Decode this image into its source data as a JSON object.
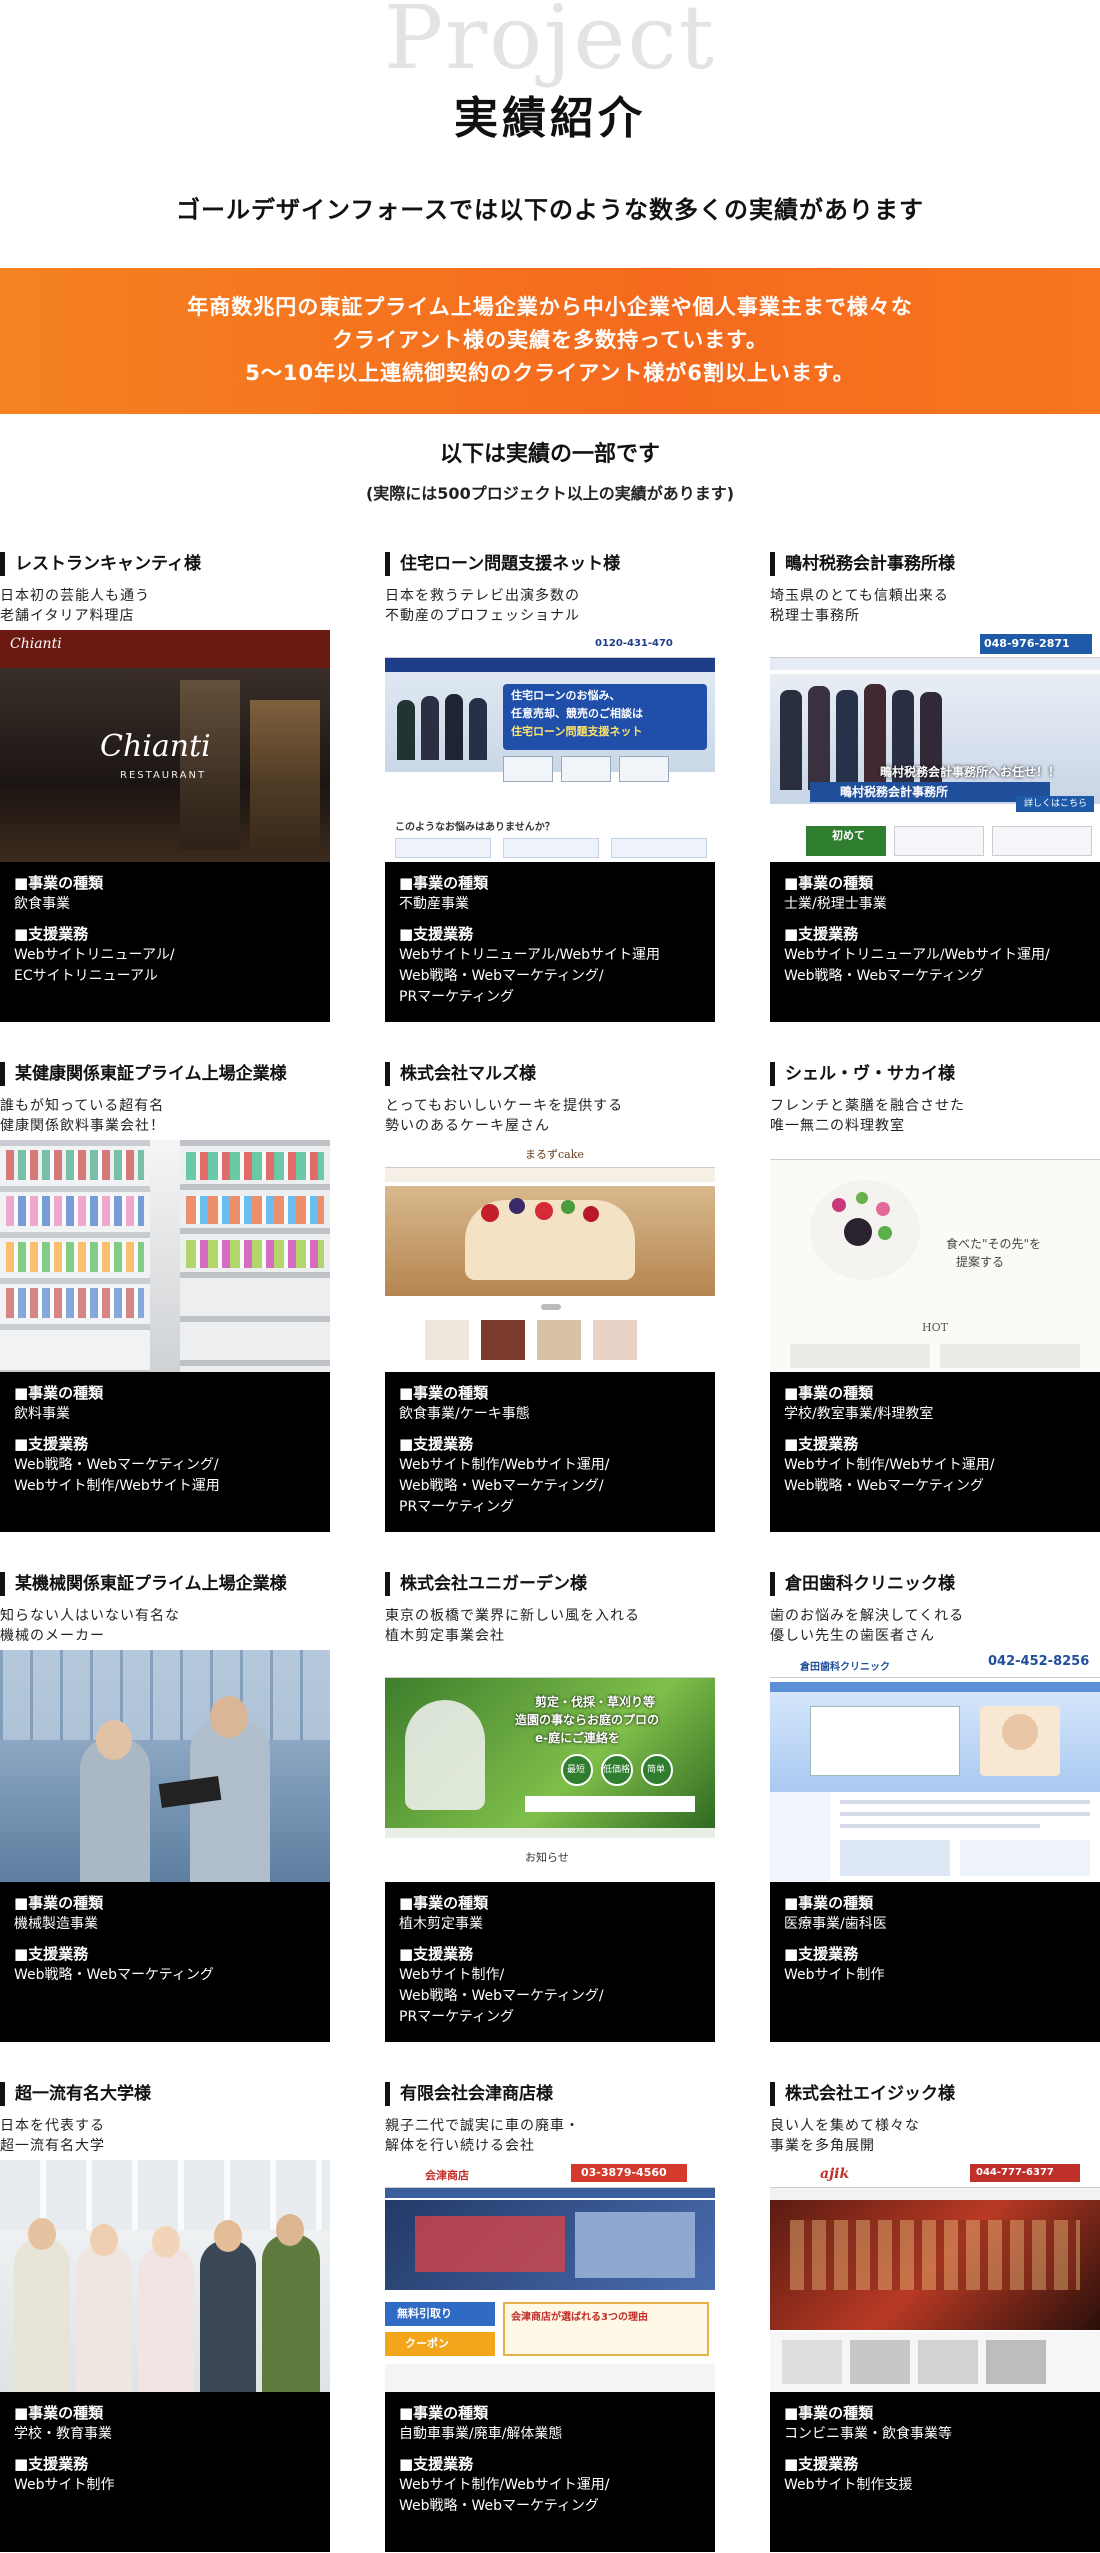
{
  "header": {
    "project_word": "Project",
    "title": "実績紹介"
  },
  "lead": "ゴールデザインフォースでは以下のような数多くの実績があります",
  "banner": {
    "lines": [
      "年商数兆円の東証プライム上場企業から中小企業や個人事業主まで様々な",
      "クライアント様の実績を多数持っています。",
      "5〜10年以上連続御契約のクライアント様が6割以上います。"
    ],
    "color": "#f58220"
  },
  "sub": {
    "line1": "以下は実績の一部です",
    "line2": "(実際には500プロジェクト以上の実績があります)"
  },
  "labels": {
    "industry": "■事業の種類",
    "support": "■支援業務"
  },
  "cards": [
    {
      "title": "レストランキャンティ様",
      "desc": [
        "日本初の芸能人も通う",
        "老舗イタリア料理店"
      ],
      "industry": "飲食事業",
      "support": [
        "Webサイトリニューアル/",
        "ECサイトリニューアル"
      ],
      "shot_text": [
        "Chianti",
        "RESTAURANT"
      ]
    },
    {
      "title": "住宅ローン問題支援ネット様",
      "desc": [
        "日本を救うテレビ出演多数の",
        "不動産のプロフェッショナル"
      ],
      "industry": "不動産事業",
      "support": [
        "Webサイトリニューアル/Webサイト運用",
        "Web戦略・Webマーケティング/",
        "PRマーケティング"
      ],
      "shot_text": [
        "住宅ローンのお悩み、",
        "任意売却、競売のご相談は",
        "住宅ローン問題支援ネット",
        "0120-431-470",
        "このようなお悩みはありませんか？"
      ]
    },
    {
      "title": "鴫村税務会計事務所様",
      "desc": [
        "埼玉県のとても信頼出来る",
        "税理士事務所"
      ],
      "industry": "士業/税理士事業",
      "support": [
        "Webサイトリニューアル/Webサイト運用/",
        "Web戦略・Webマーケティング"
      ],
      "shot_text": [
        "鴫村税務会計事務所",
        "048-976-2871",
        "鴫村税務会計事務所へお任せ！！",
        "初めて",
        "詳しくはこちら"
      ]
    },
    {
      "title": "某健康関係東証プライム上場企業様",
      "desc": [
        "誰もが知っている超有名",
        "健康関係飲料事業会社！"
      ],
      "industry": "飲料事業",
      "support": [
        "Web戦略・Webマーケティング/",
        "Webサイト制作/Webサイト運用"
      ],
      "shot_text": []
    },
    {
      "title": "株式会社マルズ様",
      "desc": [
        "とってもおいしいケーキを提供する",
        "勢いのあるケーキ屋さん"
      ],
      "industry": "飲食事業/ケーキ事態",
      "support": [
        "Webサイト制作/Webサイト運用/",
        "Web戦略・Webマーケティング/",
        "PRマーケティング"
      ],
      "shot_text": [
        "まるずcake"
      ]
    },
    {
      "title": "シェル・ヴ・サカイ様",
      "desc": [
        "フレンチと薬膳を融合させた",
        "唯一無二の料理教室"
      ],
      "industry": "学校/教室事業/料理教室",
      "support": [
        "Webサイト制作/Webサイト運用/",
        "Web戦略・Webマーケティング"
      ],
      "shot_text": [
        "食べた\"その先\"を",
        "提案する",
        "HOT"
      ]
    },
    {
      "title": "某機械関係東証プライム上場企業様",
      "desc": [
        "知らない人はいない有名な",
        "機械のメーカー"
      ],
      "industry": "機械製造事業",
      "support": [
        "Web戦略・Webマーケティング"
      ],
      "shot_text": []
    },
    {
      "title": "株式会社ユニガーデン様",
      "desc": [
        "東京の板橋で業界に新しい風を入れる",
        "植木剪定事業会社"
      ],
      "industry": "植木剪定事業",
      "support": [
        "Webサイト制作/",
        "Web戦略・Webマーケティング/",
        "PRマーケティング"
      ],
      "shot_text": [
        "剪定・伐採・草刈り等",
        "造園の事ならお庭のプロの",
        "e-庭にご連絡を",
        "最短",
        "低価格",
        "简单",
        "お知らせ"
      ]
    },
    {
      "title": "倉田歯科クリニック様",
      "desc": [
        "歯のお悩みを解決してくれる",
        "優しい先生の歯医者さん"
      ],
      "industry": "医療事業/歯科医",
      "support": [
        "Webサイト制作"
      ],
      "shot_text": [
        "倉田歯科クリニック",
        "042-452-8256"
      ]
    },
    {
      "title": "超一流有名大学様",
      "desc": [
        "日本を代表する",
        "超一流有名大学"
      ],
      "industry": "学校・教育事業",
      "support": [
        "Webサイト制作"
      ],
      "shot_text": []
    },
    {
      "title": "有限会社会津商店様",
      "desc": [
        "親子二代で誠実に車の廃車・",
        "解体を行い続ける会社"
      ],
      "industry": "自動車事業/廃車/解体業態",
      "support": [
        "Webサイト制作/Webサイト運用/",
        "Web戦略・Webマーケティング"
      ],
      "shot_text": [
        "会津商店",
        "03-3879-4560",
        "無料引取り",
        "クーポン",
        "会津商店が選ばれる3つの理由"
      ]
    },
    {
      "title": "株式会社エイジック様",
      "desc": [
        "良い人を集めて様々な",
        "事業を多角展開"
      ],
      "industry": "コンビニ事業・飲食事業等",
      "support": [
        "Webサイト制作支援"
      ],
      "shot_text": [
        "ajik",
        "044-777-6377"
      ]
    }
  ]
}
